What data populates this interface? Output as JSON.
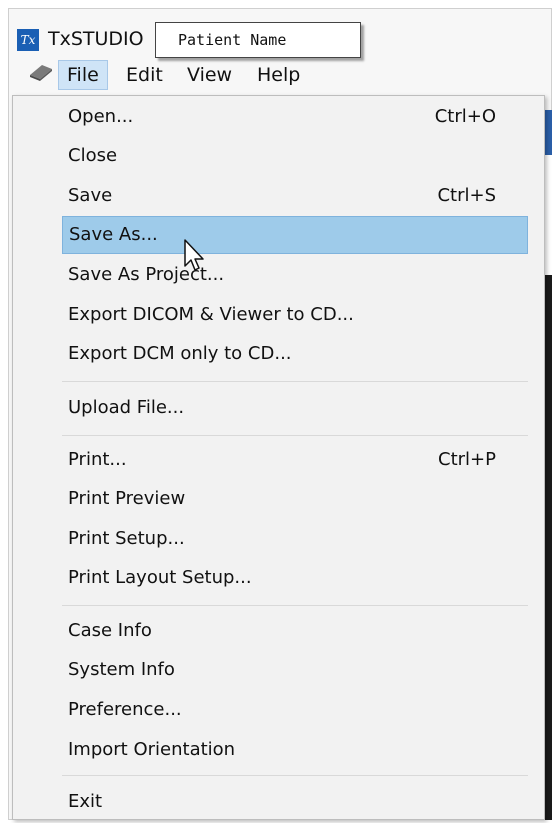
{
  "app": {
    "icon_text": "Tx",
    "title": "TxSTUDIO"
  },
  "tooltip": {
    "text": "Patient Name"
  },
  "menubar": {
    "items": [
      {
        "label": "File",
        "active": true
      },
      {
        "label": "Edit",
        "active": false
      },
      {
        "label": "View",
        "active": false
      },
      {
        "label": "Help",
        "active": false
      }
    ]
  },
  "file_menu": {
    "items": [
      {
        "label": "Open...",
        "shortcut": "Ctrl+O"
      },
      {
        "label": "Close",
        "shortcut": ""
      },
      {
        "label": "Save",
        "shortcut": "Ctrl+S"
      },
      {
        "label": "Save As...",
        "shortcut": "",
        "highlighted": true
      },
      {
        "label": "Save As Project...",
        "shortcut": ""
      },
      {
        "label": "Export DICOM & Viewer to CD...",
        "shortcut": ""
      },
      {
        "label": "Export DCM only to CD...",
        "shortcut": ""
      },
      {
        "label": "Upload File...",
        "shortcut": ""
      },
      {
        "label": "Print...",
        "shortcut": "Ctrl+P"
      },
      {
        "label": "Print Preview",
        "shortcut": ""
      },
      {
        "label": "Print Setup...",
        "shortcut": ""
      },
      {
        "label": "Print Layout Setup...",
        "shortcut": ""
      },
      {
        "label": "Case Info",
        "shortcut": ""
      },
      {
        "label": "System Info",
        "shortcut": ""
      },
      {
        "label": "Preference...",
        "shortcut": ""
      },
      {
        "label": "Import Orientation",
        "shortcut": ""
      },
      {
        "label": "Exit",
        "shortcut": ""
      }
    ]
  },
  "colors": {
    "highlight": "#9ecbea",
    "menubar_active": "#cfe4f7",
    "app_icon": "#1a5fb4"
  }
}
